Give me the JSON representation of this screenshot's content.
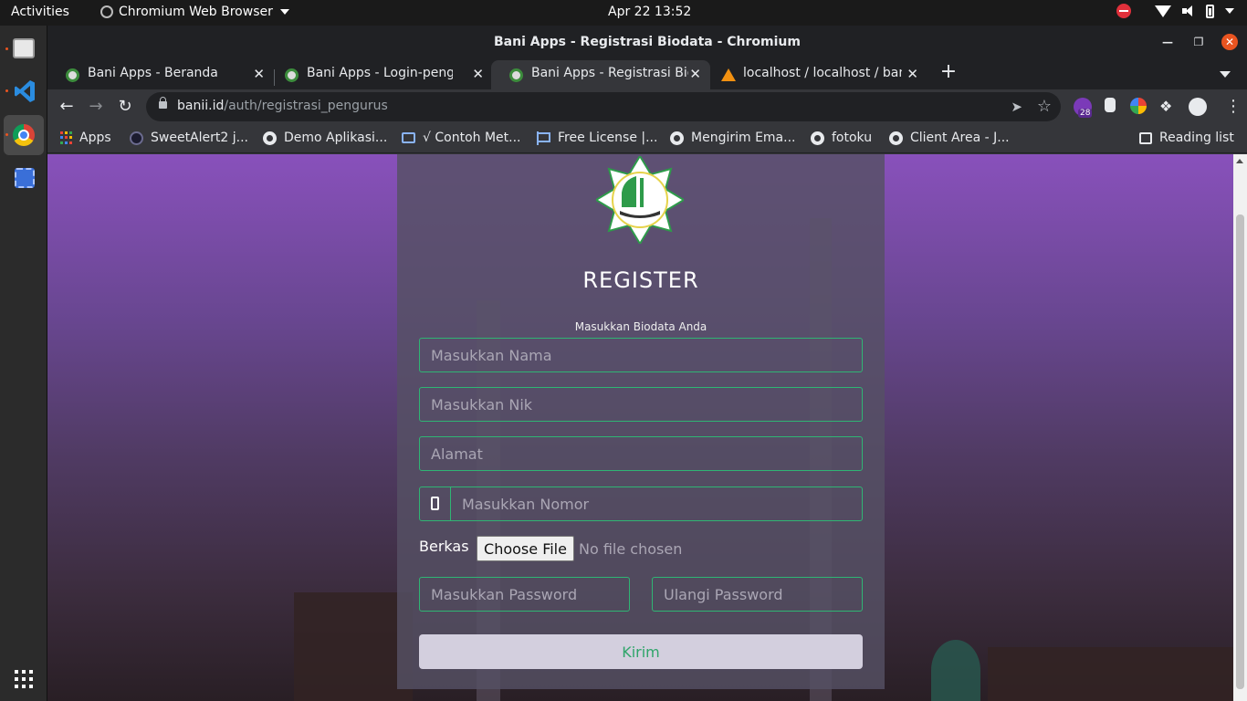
{
  "topbar": {
    "activities": "Activities",
    "app_name": "Chromium Web Browser",
    "clock": "Apr 22  13:52"
  },
  "window": {
    "title": "Bani Apps - Registrasi Biodata - Chromium"
  },
  "tabs": [
    {
      "label": "Bani Apps - Beranda",
      "favicon": "gear-icon",
      "active": false
    },
    {
      "label": "Bani Apps - Login-pengurus",
      "favicon": "gear-icon",
      "active": false
    },
    {
      "label": "Bani Apps - Registrasi Biodata",
      "favicon": "gear-icon",
      "active": true
    },
    {
      "label": "localhost / localhost / bani",
      "favicon": "phpmyadmin-icon",
      "active": false
    }
  ],
  "toolbar": {
    "url_host": "banii.id",
    "url_path": "/auth/registrasi_pengurus",
    "extension_badge": "28"
  },
  "bookmarks": [
    {
      "label": "Apps",
      "icon": "apps-grid-icon"
    },
    {
      "label": "SweetAlert2 j...",
      "icon": "sweetalert-icon"
    },
    {
      "label": "Demo Aplikasi...",
      "icon": "globe-icon"
    },
    {
      "label": "√ Contoh Met...",
      "icon": "monitor-icon"
    },
    {
      "label": "Free License |...",
      "icon": "flag-icon"
    },
    {
      "label": "Mengirim Ema...",
      "icon": "globe-icon"
    },
    {
      "label": "fotoku",
      "icon": "globe-icon"
    },
    {
      "label": "Client Area - J...",
      "icon": "globe-icon"
    }
  ],
  "reading_list": "Reading list",
  "form": {
    "title": "REGISTER",
    "subtitle": "Masukkan Biodata Anda",
    "name_placeholder": "Masukkan Nama",
    "nik_placeholder": "Masukkan Nik",
    "address_placeholder": "Alamat",
    "phone_placeholder": "Masukkan Nomor",
    "file_label": "Berkas",
    "file_button": "Choose File",
    "file_status": "No file chosen",
    "password_placeholder": "Masukkan Password",
    "confirm_placeholder": "Ulangi Password",
    "submit_label": "Kirim"
  },
  "colors": {
    "accent_green": "#2fb574",
    "card_bg": "#55506a",
    "chrome_dark": "#202124",
    "ubuntu_orange": "#e95420"
  }
}
